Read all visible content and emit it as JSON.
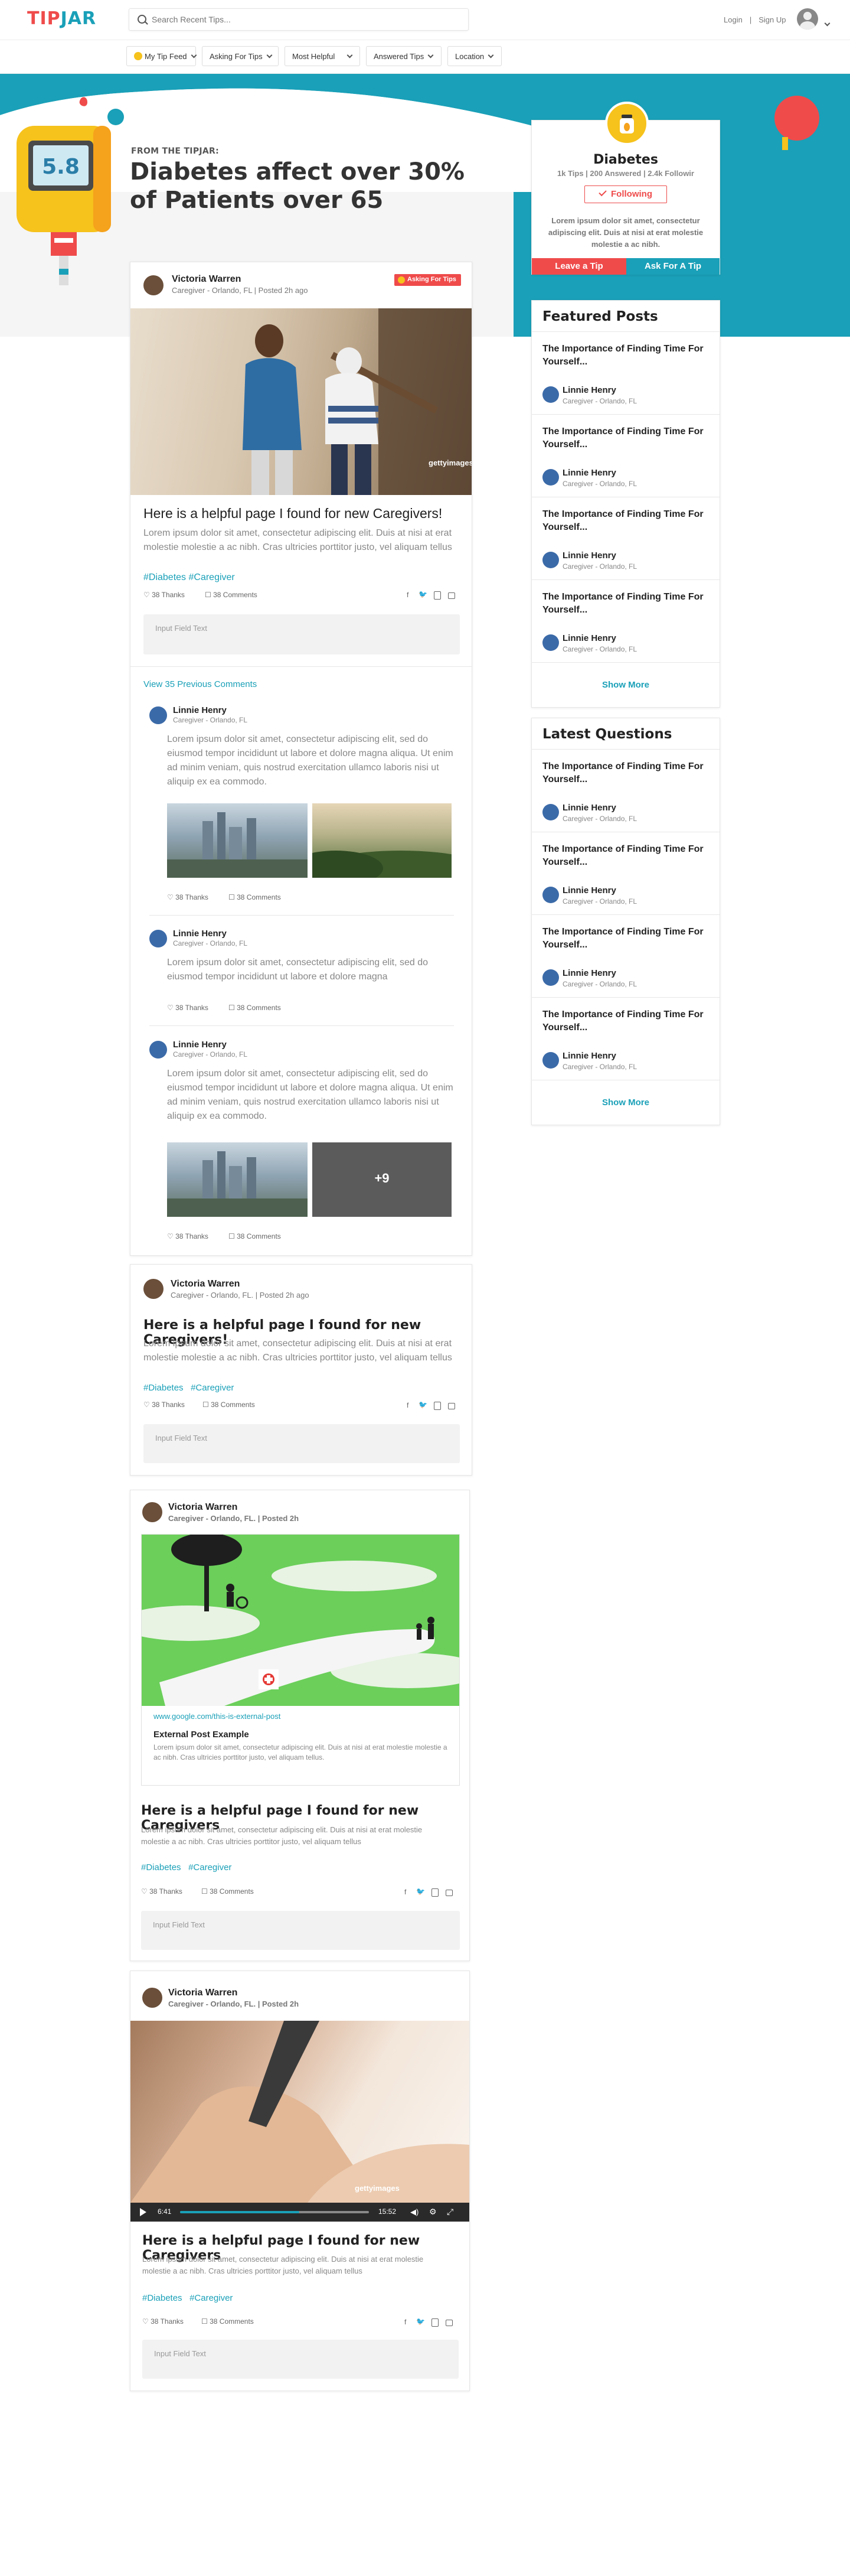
{
  "brand": {
    "logo_a": "TIP",
    "logo_b": "JAR",
    "red": "#ef4b4b",
    "teal": "#1aa0b8"
  },
  "search": {
    "placeholder": "Search Recent Tips..."
  },
  "nav": {
    "login": "Login",
    "sep": "|",
    "signup": "Sign Up"
  },
  "filters": [
    {
      "label": "My Tip Feed"
    },
    {
      "label": "Asking For Tips"
    },
    {
      "label": "Most Helpful"
    },
    {
      "label": "Answered Tips"
    },
    {
      "label": "Location"
    }
  ],
  "hero": {
    "eyebrow": "FROM THE TIPJAR:",
    "title_line1": "Diabetes affect over 30%",
    "title_line2": "of Patients over 65",
    "meter_value": "5.8"
  },
  "topic": {
    "name": "Diabetes",
    "stats": "1k Tips | 200 Answered | 2.4k Followir",
    "follow_label": "Following",
    "description": "Lorem ipsum dolor sit amet, consectetur adipiscing elit. Duis at nisi at erat molestie molestie a ac nibh.",
    "leave_tip": "Leave a Tip",
    "ask_tip": "Ask For A Tip"
  },
  "featured": {
    "heading": "Featured Posts",
    "items": [
      {
        "title": "The Importance of Finding Time For Yourself...",
        "name": "Linnie Henry",
        "sub": "Caregiver - Orlando, FL"
      },
      {
        "title": "The Importance of Finding Time For Yourself...",
        "name": "Linnie Henry",
        "sub": "Caregiver - Orlando, FL"
      },
      {
        "title": "The Importance of Finding Time For Yourself...",
        "name": "Linnie Henry",
        "sub": "Caregiver - Orlando, FL"
      },
      {
        "title": "The Importance of Finding Time For Yourself...",
        "name": "Linnie Henry",
        "sub": "Caregiver - Orlando, FL"
      }
    ],
    "show_more": "Show More"
  },
  "latest": {
    "heading": "Latest Questions",
    "items": [
      {
        "title": "The Importance of Finding Time For Yourself...",
        "name": "Linnie Henry",
        "sub": "Caregiver - Orlando, FL"
      },
      {
        "title": "The Importance of Finding Time For Yourself...",
        "name": "Linnie Henry",
        "sub": "Caregiver - Orlando, FL"
      },
      {
        "title": "The Importance of Finding Time For Yourself...",
        "name": "Linnie Henry",
        "sub": "Caregiver - Orlando, FL"
      },
      {
        "title": "The Importance of Finding Time For Yourself...",
        "name": "Linnie Henry",
        "sub": "Caregiver - Orlando, FL"
      }
    ],
    "show_more": "Show More"
  },
  "post1": {
    "name": "Victoria Warren",
    "sub": "Caregiver - Orlando, FL  |  Posted 2h ago",
    "badge": "Asking For Tips",
    "photo_credit": "gettyimages",
    "title": "Here is a helpful page I found for new Caregivers!",
    "body": "Lorem ipsum dolor sit amet, consectetur adipiscing elit. Duis at nisi at erat molestie molestie a ac nibh. Cras ultricies porttitor justo, vel aliquam tellus",
    "tags": "#Diabetes #Caregiver",
    "thanks": "38 Thanks",
    "comments": "38 Comments",
    "input": "Input Field Text",
    "view_prev": "View 35 Previous Comments",
    "comment_list": [
      {
        "name": "Linnie Henry",
        "sub": "Caregiver - Orlando, FL",
        "text": "Lorem ipsum dolor sit amet, consectetur adipiscing elit, sed do eiusmod tempor incididunt ut labore et dolore magna aliqua. Ut enim ad minim veniam, quis nostrud exercitation ullamco laboris nisi ut aliquip ex ea commodo.",
        "thanks": "38 Thanks",
        "comments": "38 Comments"
      },
      {
        "name": "Linnie Henry",
        "sub": "Caregiver - Orlando, FL",
        "text": "Lorem ipsum dolor sit amet, consectetur adipiscing elit, sed do eiusmod tempor incididunt ut labore et dolore magna",
        "thanks": "38 Thanks",
        "comments": "38 Comments"
      },
      {
        "name": "Linnie Henry",
        "sub": "Caregiver - Orlando, FL",
        "text": "Lorem ipsum dolor sit amet, consectetur adipiscing elit, sed do eiusmod tempor incididunt ut labore et dolore magna aliqua. Ut enim ad minim veniam, quis nostrud exercitation ullamco laboris nisi ut aliquip ex ea commodo.",
        "thanks": "38 Thanks",
        "comments": "38 Comments",
        "more": "+9"
      }
    ]
  },
  "post2": {
    "name": "Victoria Warren",
    "sub": "Caregiver - Orlando, FL.  |  Posted 2h ago",
    "title": "Here is a helpful page I found for new Caregivers!",
    "body": "Lorem ipsum dolor sit amet, consectetur adipiscing elit. Duis at nisi at erat molestie molestie a ac nibh. Cras ultricies porttitor justo, vel aliquam tellus",
    "tag1": "#Diabetes",
    "tag2": "#Caregiver",
    "thanks": "38 Thanks",
    "comments": "38 Comments",
    "input": "Input Field Text"
  },
  "post3": {
    "name": "Victoria Warren",
    "sub": "Caregiver - Orlando, FL. | Posted 2h",
    "link_url": "www.google.com/this-is-external-post",
    "link_title": "External Post Example",
    "link_body": "Lorem ipsum dolor sit amet, consectetur adipiscing elit. Duis at nisi at erat molestie molestie a ac nibh. Cras ultricies porttitor justo, vel aliquam tellus.",
    "title": "Here is a helpful page I found for new Caregivers",
    "body": "Lorem ipsum dolor sit amet, consectetur adipiscing elit. Duis at nisi at erat molestie molestie a ac nibh. Cras ultricies porttitor justo, vel aliquam tellus",
    "tag1": "#Diabetes",
    "tag2": "#Caregiver",
    "thanks": "38 Thanks",
    "comments": "38 Comments",
    "input": "Input Field Text"
  },
  "post4": {
    "name": "Victoria Warren",
    "sub": "Caregiver - Orlando, FL. | Posted 2h",
    "photo_credit": "gettyimages",
    "time_current": "6:41",
    "time_total": "15:52",
    "progress": 0.63,
    "title": "Here is a helpful page I found for new Caregivers",
    "body": "Lorem ipsum dolor sit amet, consectetur adipiscing elit. Duis at nisi at erat molestie molestie a ac nibh. Cras ultricies porttitor justo, vel aliquam tellus",
    "tag1": "#Diabetes",
    "tag2": "#Caregiver",
    "thanks": "38 Thanks",
    "comments": "38 Comments",
    "input": "Input Field Text"
  }
}
